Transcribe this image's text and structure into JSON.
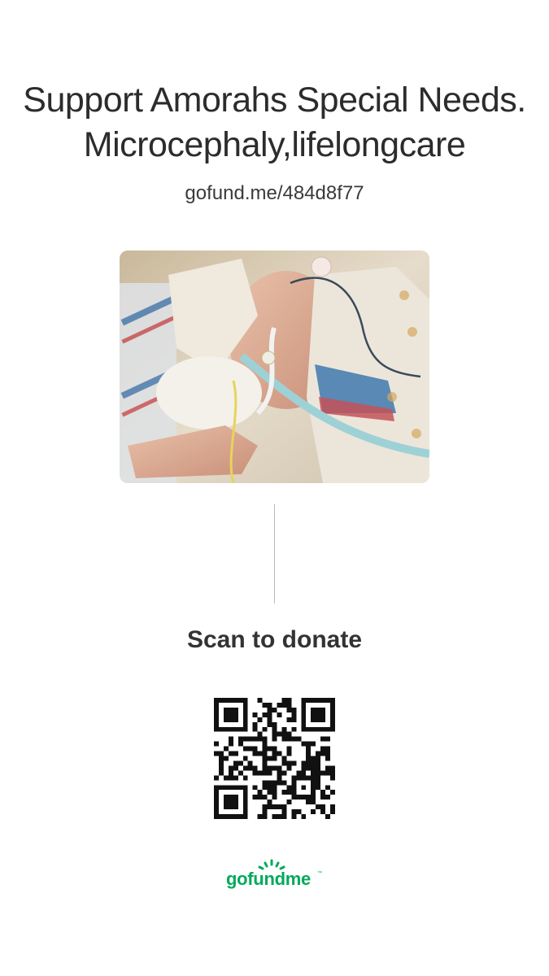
{
  "campaign": {
    "title_line1": "Support Amorahs Special Needs.",
    "title_line2": "Microcephaly,lifelongcare",
    "short_url": "gofund.me/484d8f77"
  },
  "photo": {
    "alt": "Campaign photo"
  },
  "donate": {
    "scan_label": "Scan to donate",
    "qr_label": "QR code"
  },
  "brand": {
    "name": "gofundme",
    "trademark": "™",
    "color": "#02a95c"
  },
  "colors": {
    "text": "#2c2c2c",
    "divider": "#b9b9b9",
    "background": "#ffffff"
  }
}
